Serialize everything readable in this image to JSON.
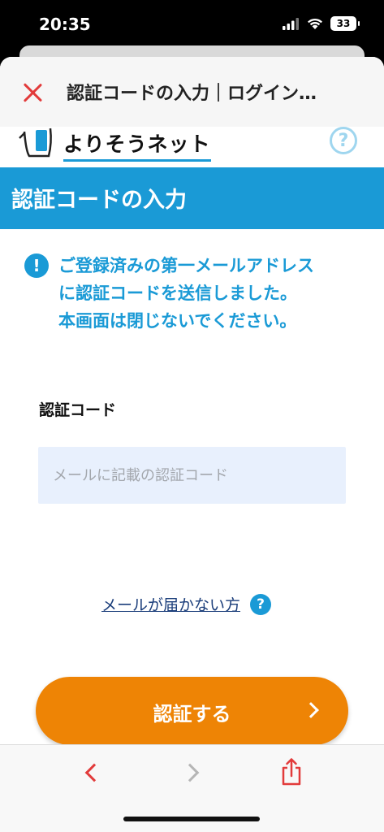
{
  "status_bar": {
    "time": "20:35",
    "battery": "33"
  },
  "sheet_header": {
    "title": "認証コードの入力｜ログイン…"
  },
  "logo": {
    "text": "よりそうネット",
    "help_symbol": "?"
  },
  "page": {
    "banner_title": "認証コードの入力"
  },
  "info": {
    "icon_symbol": "!",
    "lines": [
      "ご登録済みの第一メールアドレス",
      "に認証コードを送信しました。",
      "本画面は閉じないでください。"
    ]
  },
  "form": {
    "code_label": "認証コード",
    "code_placeholder": "メールに記載の認証コード",
    "code_value": ""
  },
  "help": {
    "link_text": "メールが届かない方",
    "icon_symbol": "?"
  },
  "submit": {
    "label": "認証する"
  },
  "icons": {
    "signal": "cellular-signal-icon",
    "wifi": "wifi-icon",
    "close": "close-icon",
    "back": "chevron-left-icon",
    "forward": "chevron-right-icon",
    "share": "share-icon"
  },
  "colors": {
    "brand_blue": "#1a9ad6",
    "button_orange": "#ee8405",
    "close_red": "#e23b3b",
    "input_bg": "#e8f0fd"
  }
}
